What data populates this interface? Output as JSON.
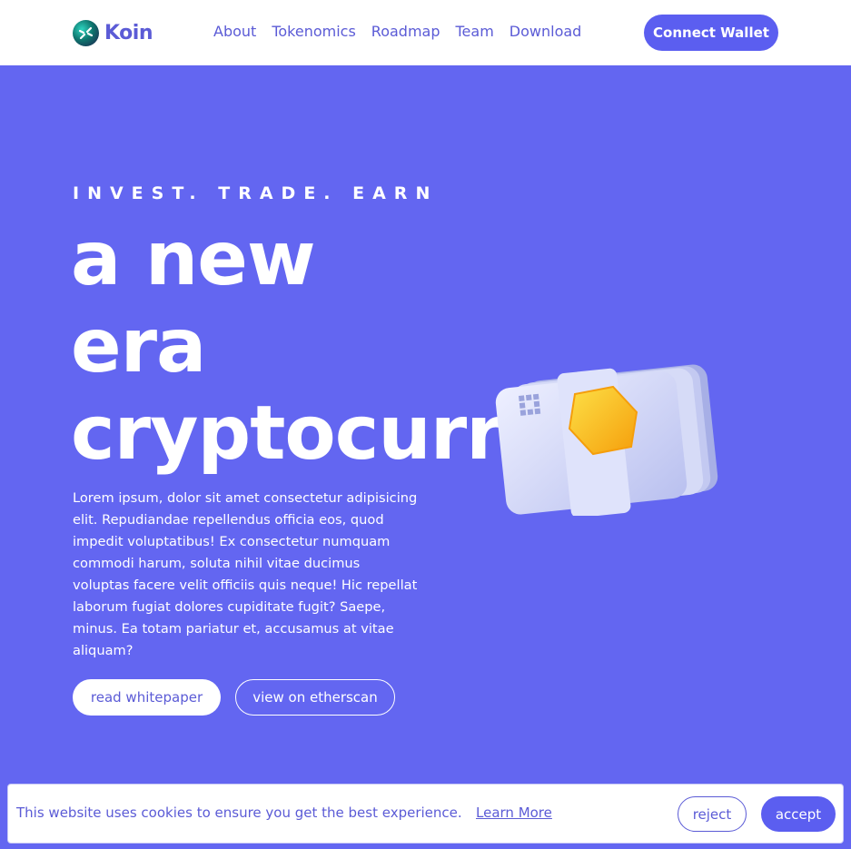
{
  "nav": {
    "logo_text": "Koin",
    "links": [
      "About",
      "Tokenomics",
      "Roadmap",
      "Team",
      "Download"
    ],
    "connect_label": "Connect Wallet"
  },
  "hero": {
    "tagline": "INVEST. TRADE. EARN",
    "headline_lines": [
      "a new",
      "era",
      "cryptocurrency"
    ],
    "description": "Lorem ipsum, dolor sit amet consectetur adipisicing elit. Repudiandae repellendus officia eos, quod impedit voluptatibus! Ex consectetur numquam commodi harum, soluta nihil vitae ducimus voluptas facere velit officiis quis neque! Hic repellat laborum fugiat dolores cupiditate fugit? Saepe, minus. Ea totam pariatur et, accusamus at vitae aliquam?",
    "primary_button": "read whitepaper",
    "secondary_button": "view on etherscan"
  },
  "cookie": {
    "message": "This website uses cookies to ensure you get the best experience.",
    "link": "Learn More",
    "reject": "reject",
    "accept": "accept"
  },
  "colors": {
    "primary": "#6366f1",
    "button": "#5b5ef0",
    "white": "#ffffff",
    "coin": "#fbbf24"
  }
}
